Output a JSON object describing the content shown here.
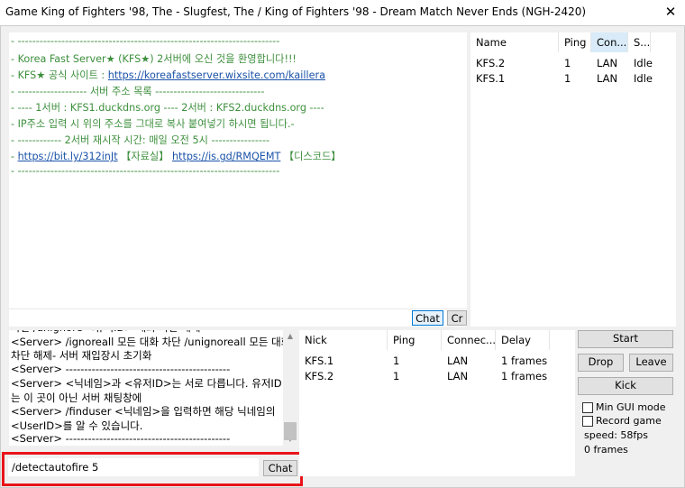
{
  "window": {
    "title": "Game King of Fighters '98, The - Slugfest, The / King of Fighters '98 - Dream Match Never Ends (NGH-2420)",
    "close_glyph": "✕"
  },
  "server_messages": [
    {
      "parts": [
        {
          "t": "- ------------------------------------------------------------------------"
        }
      ]
    },
    {
      "parts": [
        {
          "t": "- Korea Fast Server★ (KFS★) 2서버에 오신 것을 환영합니다!!!"
        }
      ]
    },
    {
      "parts": [
        {
          "t": "- KFS★ 공식 사이트 : "
        },
        {
          "t": "https://koreafastserver.wixsite.com/kaillera",
          "link": true
        }
      ]
    },
    {
      "parts": [
        {
          "t": "- ------------------- 서버 주소 목록 ------------------------------"
        }
      ]
    },
    {
      "parts": [
        {
          "t": "- ---- 1서버 : KFS1.duckdns.org ---- 2서버 : KFS2.duckdns.org ----"
        }
      ]
    },
    {
      "parts": [
        {
          "t": "- IP주소 입력 시 위의 주소를 그대로 복사 붙여넣기 하시면 됩니다.-"
        }
      ]
    },
    {
      "parts": [
        {
          "t": "- ------------ 2서버 재시작 시간: 매일 오전 5시 ----------------"
        }
      ]
    },
    {
      "parts": [
        {
          "t": "- "
        },
        {
          "t": "https://bit.ly/312inJt",
          "link": true
        },
        {
          "t": " 【자료실】 "
        },
        {
          "t": "https://is.gd/RMQEMT",
          "link": true
        },
        {
          "t": " 【디스코드】"
        }
      ]
    },
    {
      "parts": [
        {
          "t": "- ------------------------------------------------------------------------"
        }
      ]
    }
  ],
  "message_bar": {
    "chat_label": "Chat",
    "create_label": "Cr"
  },
  "server_list": {
    "columns": [
      "Name",
      "Ping",
      "Con...",
      "S..."
    ],
    "rows": [
      [
        "KFS.2",
        "1",
        "LAN",
        "Idle"
      ],
      [
        "KFS.1",
        "1",
        "LAN",
        "Idle"
      ]
    ]
  },
  "chat_log": [
    "차단 /unignore <유저ID> 대화 차단 해제",
    "<Server> /ignoreall 모든 대화 차단 /unignoreall 모든 대화",
    "차단 해제- 서버 재입장시 초기화",
    "<Server> --------------------------------------------",
    "<Server> <닉네임>과 <유저ID>는 서로 다릅니다. 유저ID",
    "는 이 곳이 아닌 서버 채팅창에",
    "<Server> /finduser <닉네임>을 입력하면 해당 닉네임의",
    "<UserID>를 알 수 있습니다.",
    "<Server> --------------------------------------------"
  ],
  "chat_input": {
    "value": "/detectautofire 5",
    "send_label": "Chat"
  },
  "users_list": {
    "columns": [
      "Nick",
      "Ping",
      "Connec...",
      "Delay"
    ],
    "rows": [
      [
        "KFS.1",
        "1",
        "LAN",
        "1 frames"
      ],
      [
        "KFS.2",
        "1",
        "LAN",
        "1 frames"
      ]
    ]
  },
  "controls": {
    "start_label": "Start",
    "drop_label": "Drop",
    "leave_label": "Leave",
    "kick_label": "Kick",
    "min_gui_label": "Min GUI mode",
    "record_label": "Record game",
    "speed_text": "speed: 58fps",
    "frames_text": "0 frames"
  }
}
